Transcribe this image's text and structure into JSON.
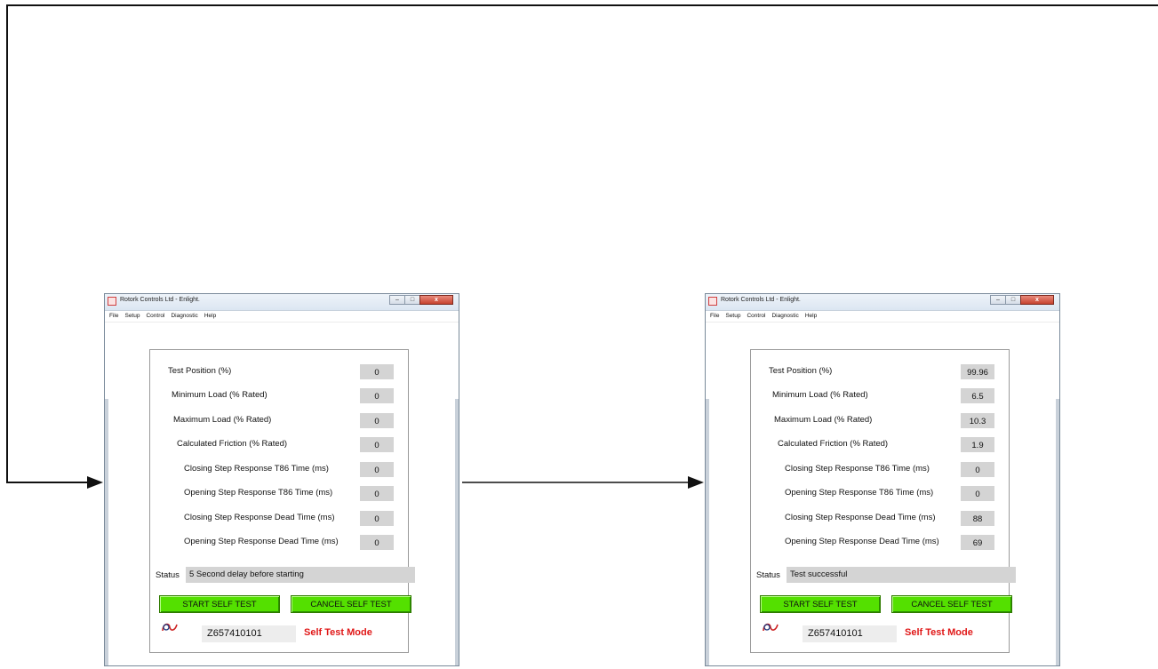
{
  "windows": [
    {
      "title": "Rotork Controls Ltd - Enlight.",
      "menu": [
        "File",
        "Setup",
        "Control",
        "Diagnostic",
        "Help"
      ],
      "rows": [
        {
          "label": "Test Position (%)",
          "value": "0"
        },
        {
          "label": "Minimum Load (% Rated)",
          "value": "0"
        },
        {
          "label": "Maximum Load (% Rated)",
          "value": "0"
        },
        {
          "label": "Calculated Friction (% Rated)",
          "value": "0"
        },
        {
          "label": "Closing Step Response T86 Time (ms)",
          "value": "0"
        },
        {
          "label": "Opening Step Response T86 Time (ms)",
          "value": "0"
        },
        {
          "label": "Closing Step Response Dead Time (ms)",
          "value": "0"
        },
        {
          "label": "Opening Step Response Dead Time (ms)",
          "value": "0"
        }
      ],
      "status_label": "Status",
      "status_value": "5 Second delay before starting",
      "start_button": "START SELF TEST",
      "cancel_button": "CANCEL SELF TEST",
      "serial": "Z657410101",
      "mode": "Self Test Mode"
    },
    {
      "title": "Rotork Controls Ltd - Enlight.",
      "menu": [
        "File",
        "Setup",
        "Control",
        "Diagnostic",
        "Help"
      ],
      "rows": [
        {
          "label": "Test Position (%)",
          "value": "99.96"
        },
        {
          "label": "Minimum Load (% Rated)",
          "value": "6.5"
        },
        {
          "label": "Maximum Load (% Rated)",
          "value": "10.3"
        },
        {
          "label": "Calculated Friction (% Rated)",
          "value": "1.9"
        },
        {
          "label": "Closing Step Response T86 Time (ms)",
          "value": "0"
        },
        {
          "label": "Opening Step Response T86 Time (ms)",
          "value": "0"
        },
        {
          "label": "Closing Step Response Dead Time (ms)",
          "value": "88"
        },
        {
          "label": "Opening Step Response Dead Time (ms)",
          "value": "69"
        }
      ],
      "status_label": "Status",
      "status_value": "Test successful",
      "start_button": "START SELF TEST",
      "cancel_button": "CANCEL SELF TEST",
      "serial": "Z657410101",
      "mode": "Self Test Mode"
    }
  ],
  "colors": {
    "button_green": "#54e000",
    "value_box": "#d4d4d4",
    "mode_text": "#e01818",
    "close_button": "#c6432f"
  }
}
